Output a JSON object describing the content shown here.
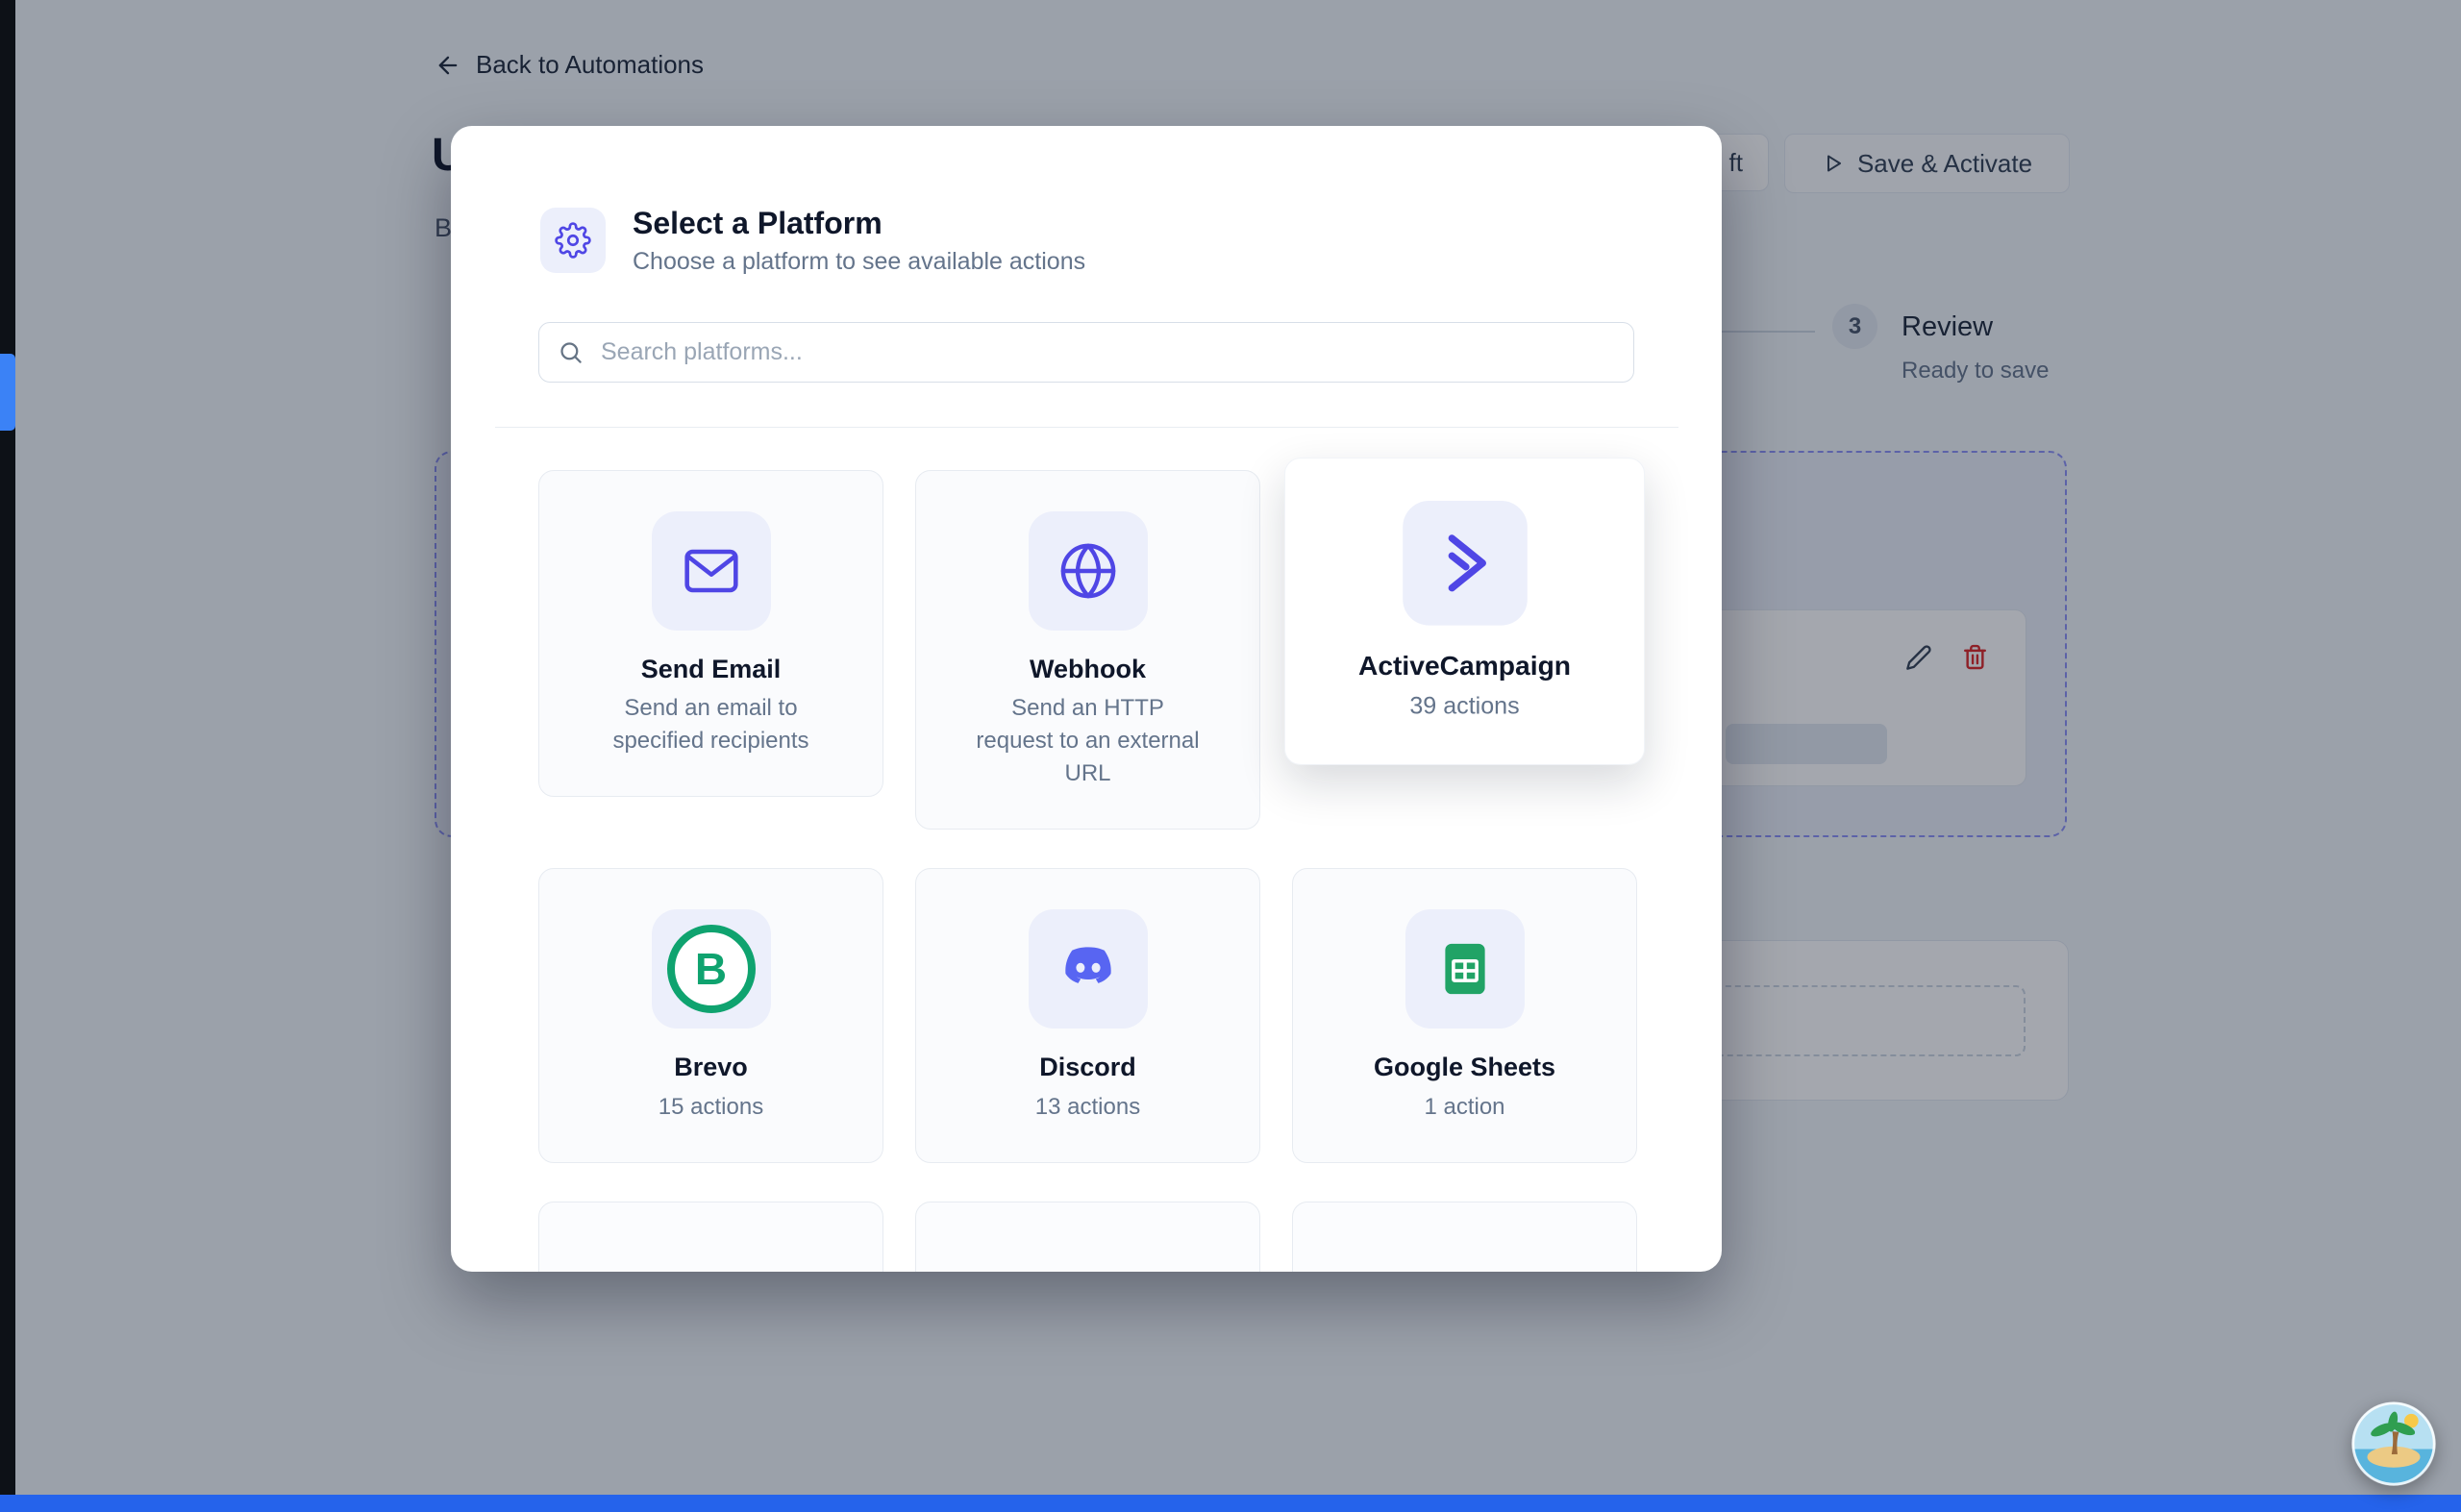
{
  "colors": {
    "accent": "#4f46e5",
    "accent-soft": "#eceffb",
    "discord": "#5865F2",
    "brevo-green": "#0fa36f",
    "sheets-green": "#21a366",
    "danger": "#dc2626",
    "accent-bar": "#2563eb",
    "sidebar-dark": "#0d1117",
    "dashed-indigo": "#8b90f5"
  },
  "page": {
    "back_link": "Back to Automations",
    "title_fragment": "U",
    "subtitle_fragment": "B",
    "toolbar": {
      "draft_fragment": "ft",
      "save_activate": "Save & Activate"
    },
    "stepper": {
      "number": "3",
      "label": "Review",
      "status": "Ready to save"
    }
  },
  "modal": {
    "title": "Select a Platform",
    "subtitle": "Choose a platform to see available actions",
    "search": {
      "placeholder": "Search platforms..."
    },
    "platforms": [
      {
        "name": "Send Email",
        "description": "Send an email to\nspecified recipients"
      },
      {
        "name": "Webhook",
        "description": "Send an HTTP\nrequest to an external\nURL"
      },
      {
        "name": "ActiveCampaign",
        "description": "39 actions"
      },
      {
        "name": "Brevo",
        "description": "15 actions"
      },
      {
        "name": "Discord",
        "description": "13 actions"
      },
      {
        "name": "Google Sheets",
        "description": "1 action"
      }
    ]
  }
}
